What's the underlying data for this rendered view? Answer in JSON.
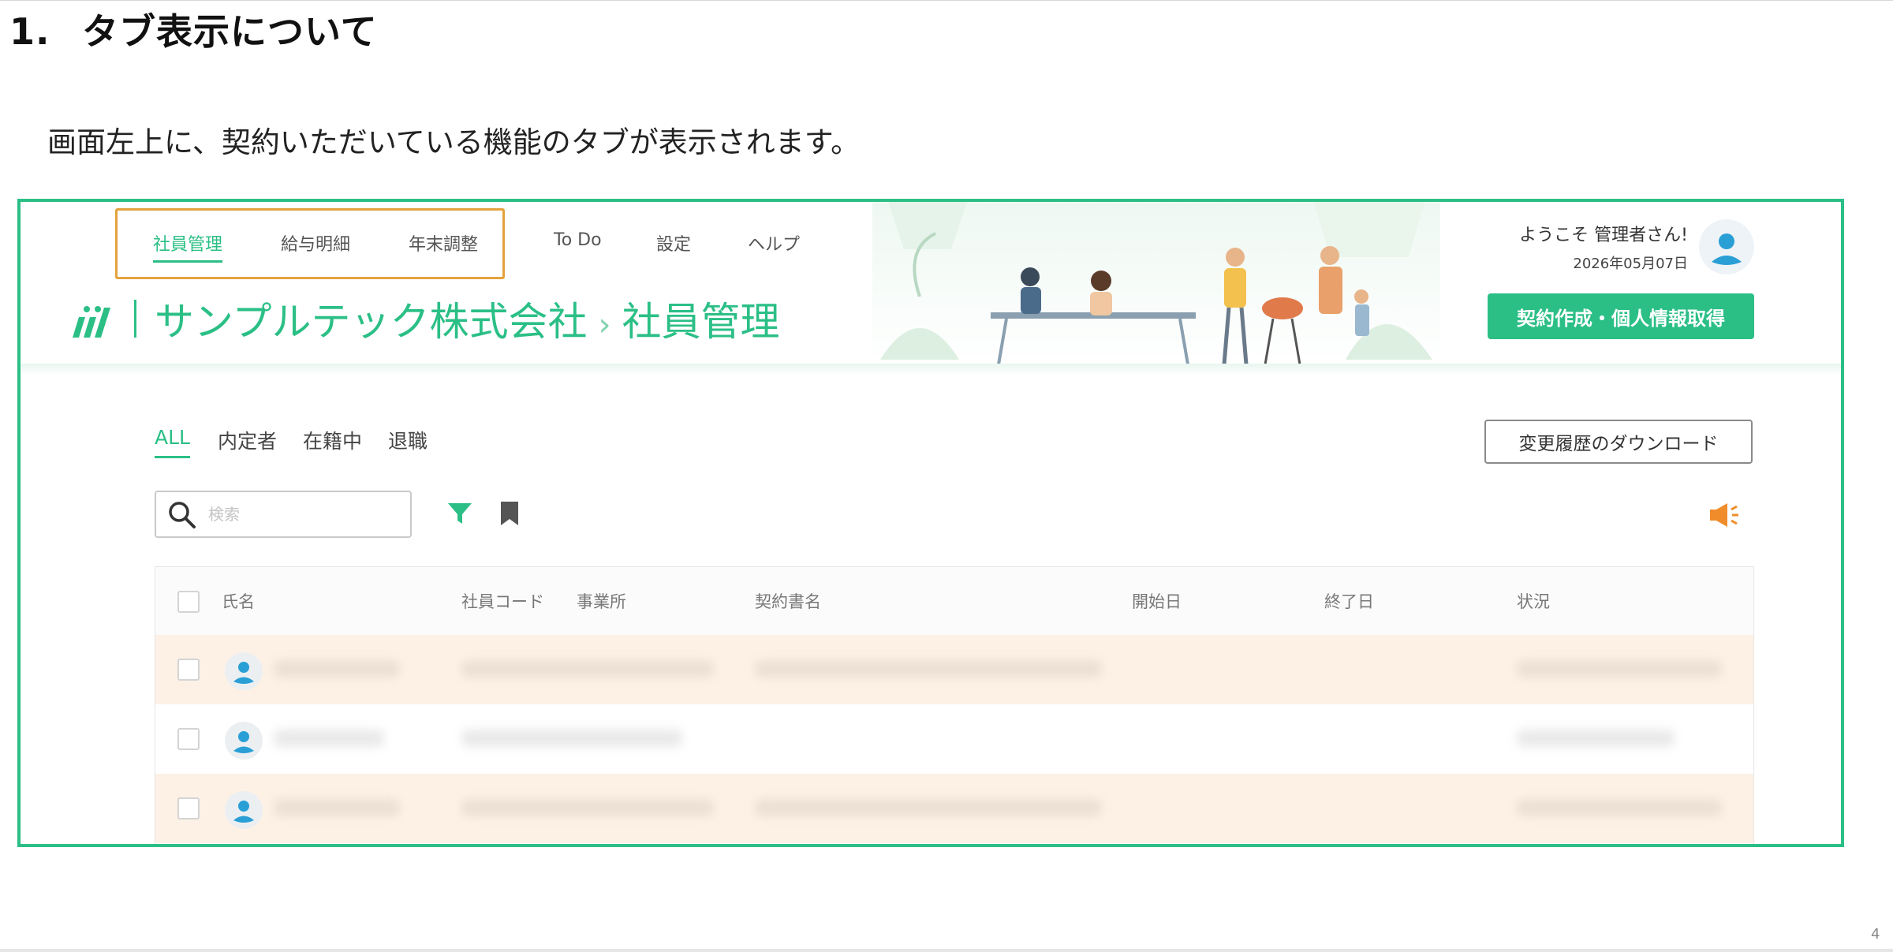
{
  "document": {
    "heading_number": "1.",
    "heading_text": "タブ表示について",
    "body_text": "画面左上に、契約いただいている機能のタブが表示されます。",
    "page_mark": "4"
  },
  "app": {
    "nav_tabs": [
      {
        "label": "社員管理",
        "active": true
      },
      {
        "label": "給与明細"
      },
      {
        "label": "年末調整"
      },
      {
        "label": "To Do"
      },
      {
        "label": "設定"
      },
      {
        "label": "ヘルプ"
      }
    ],
    "breadcrumb": {
      "company": "サンプルテック株式会社",
      "separator": "›",
      "page": "社員管理"
    },
    "welcome": "ようこそ 管理者さん!",
    "date": "2026年05月07日",
    "cta_label": "契約作成・個人情報取得",
    "filter_tabs": [
      {
        "label": "ALL",
        "active": true
      },
      {
        "label": "内定者"
      },
      {
        "label": "在籍中"
      },
      {
        "label": "退職"
      }
    ],
    "download_label": "変更履歴のダウンロード",
    "search_placeholder": "検索",
    "table_headers": [
      "氏名",
      "社員コード",
      "事業所",
      "契約書名",
      "開始日",
      "終了日",
      "状況"
    ]
  },
  "colors": {
    "accent": "#2bbf86",
    "highlight": "#e4a23c",
    "row_alt": "#fdf1e6",
    "icon_orange": "#f08c2a"
  },
  "icons": [
    "logo-mark",
    "search-icon",
    "filter-icon",
    "bookmark-icon",
    "megaphone-icon",
    "user-avatar-icon"
  ]
}
